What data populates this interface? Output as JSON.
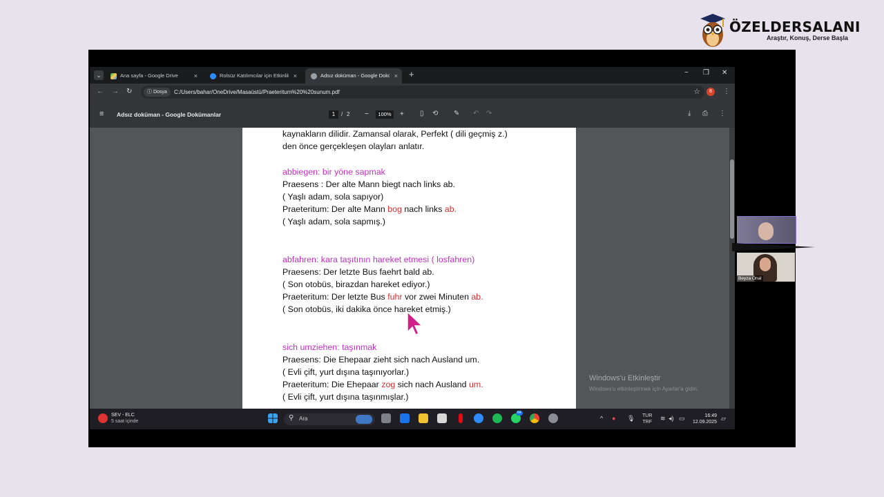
{
  "brand": {
    "name": "ÖZELDERSALANI",
    "tagline": "Araştır, Konuş, Derse Başla"
  },
  "browser": {
    "tabs": [
      {
        "label": "Ana sayfa - Google Drive",
        "close": "×"
      },
      {
        "label": "Rolsüz Katılımcılar için Etkinlik",
        "close": "×"
      },
      {
        "label": "Adsız doküman - Google Doküm",
        "close": "×"
      }
    ],
    "new_tab": "+",
    "window_controls": {
      "minimize": "−",
      "restore": "❐",
      "close": "✕"
    },
    "nav": {
      "back": "←",
      "forward": "→",
      "reload": "↻"
    },
    "address_chip": "Dosya",
    "url": "C:/Users/bahar/OneDrive/Masaüstü/Praeteritum%20%20sunum.pdf",
    "profile_badge": "8"
  },
  "pdf_toolbar": {
    "menu_icon": "≡",
    "title": "Adsız doküman - Google Dokümanlar",
    "page_current": "1",
    "page_sep": "/",
    "page_total": "2",
    "zoom_out": "−",
    "zoom": "100%",
    "zoom_in": "+"
  },
  "document": {
    "lines": [
      {
        "text": "kaynakların dilidir. Zamansal olarak, Perfekt ( dili geçmiş z.)",
        "style": "normal"
      },
      {
        "text": "den önce gerçekleşen olayları anlatır.",
        "style": "normal"
      },
      {
        "text": "abbiegen:  bir  yöne  sapmak",
        "style": "head"
      },
      {
        "text": "Praesens : Der alte Mann biegt nach links ab.",
        "style": "normal"
      },
      {
        "text": "( Yaşlı adam, sola sapıyor)",
        "style": "normal"
      },
      {
        "parts": [
          {
            "t": "Praeteritum: Der alte Mann ",
            "c": "n"
          },
          {
            "t": "bog",
            "c": "r"
          },
          {
            "t": "  nach links  ",
            "c": "n"
          },
          {
            "t": "ab.",
            "c": "r"
          }
        ],
        "style": "mixed"
      },
      {
        "text": "( Yaşlı  adam, sola sapmış.)",
        "style": "normal"
      },
      {
        "text": "abfahren: kara taşıtının  hareket etmesi ( losfahren)",
        "style": "head"
      },
      {
        "text": "Praesens:  Der letzte Bus faehrt bald ab.",
        "style": "normal"
      },
      {
        "text": "( Son otobüs, birazdan hareket ediyor.)",
        "style": "normal"
      },
      {
        "parts": [
          {
            "t": "Praeteritum: Der letzte Bus ",
            "c": "n"
          },
          {
            "t": "fuhr",
            "c": "r"
          },
          {
            "t": " vor zwei Minuten ",
            "c": "n"
          },
          {
            "t": "ab.",
            "c": "r"
          }
        ],
        "style": "mixed"
      },
      {
        "text": "( Son otobüs, iki dakika önce hareket etmiş.)",
        "style": "normal"
      },
      {
        "text": "sich umziehen:  taşınmak",
        "style": "head"
      },
      {
        "text": "Praesens: Die Ehepaar zieht sich nach Ausland um.",
        "style": "normal"
      },
      {
        "text": "(  Evli çift, yurt dışına taşınıyorlar.)",
        "style": "normal"
      },
      {
        "parts": [
          {
            "t": "Praeteritum: Die Ehepaar ",
            "c": "n"
          },
          {
            "t": "zog",
            "c": "r"
          },
          {
            "t": " sich nach Ausland ",
            "c": "n"
          },
          {
            "t": "um.",
            "c": "r"
          }
        ],
        "style": "mixed"
      },
      {
        "text": "(  Evli çift, yurt dışına taşınmışlar.)",
        "style": "normal"
      }
    ]
  },
  "activation": {
    "title": "Windows'u Etkinleştir",
    "subtitle": "Windows'u etkinleştirmek için Ayarlar'a gidin."
  },
  "taskbar": {
    "weather_title": "SEV - ELC",
    "weather_sub": "5 saat içinde",
    "search_placeholder": "Ara",
    "lang_1": "TUR",
    "lang_2": "TRF",
    "time": "16:49",
    "date": "12.09.2025",
    "whatsapp_badge": "64"
  },
  "participants": [
    {
      "name": ""
    },
    {
      "name": "Beyza Önal"
    }
  ],
  "colors": {
    "heading": "#c030c0",
    "verb_highlight": "#d03030",
    "accent_frame": "#8d6fd3"
  }
}
